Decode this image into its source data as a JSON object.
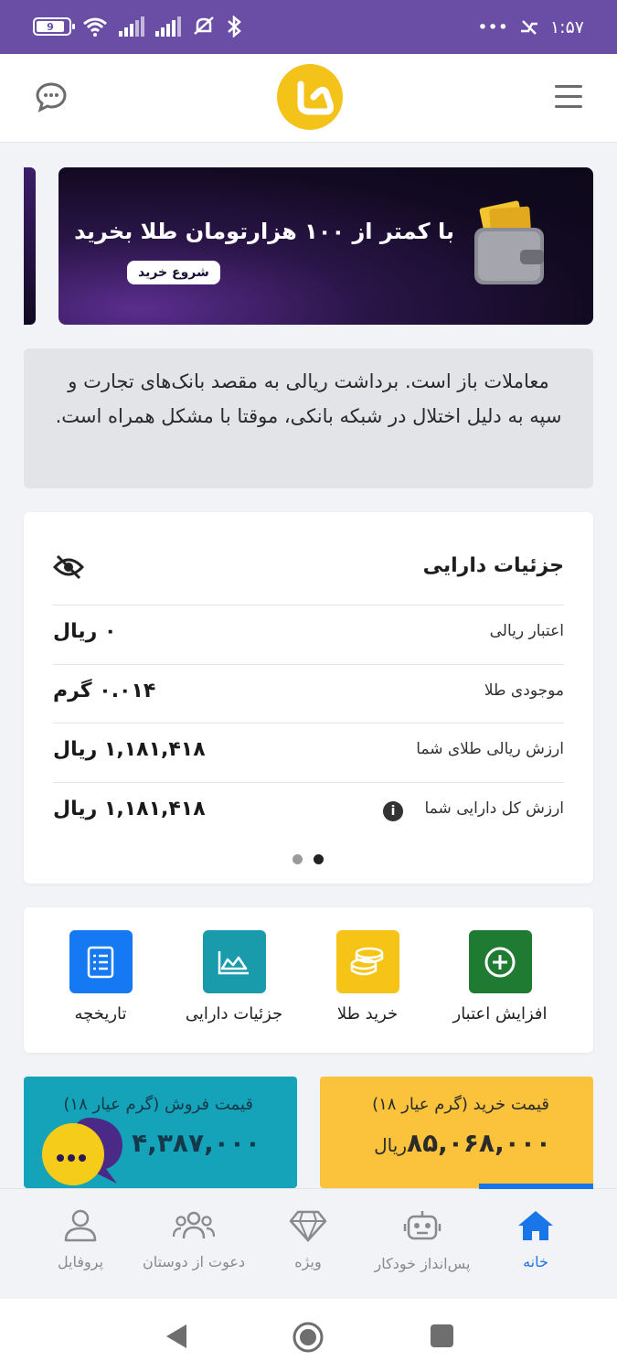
{
  "status_bar": {
    "time": "۱:۵۷",
    "battery": "9",
    "dots": "•••"
  },
  "banner": {
    "title": "با کمتر از ۱۰۰ هزارتومان طلا بخرید",
    "button": "شروع خرید"
  },
  "notice": {
    "text": "معاملات باز است. برداشت ریالی به مقصد بانک‌های تجارت و سپه به دلیل اختلال در شبکه بانکی، موقتا با مشکل همراه است."
  },
  "assets": {
    "title": "جزئیات دارایی",
    "rows": [
      {
        "label": "اعتبار ریالی",
        "value": "۰ ریال"
      },
      {
        "label": "موجودی طلا",
        "value": "۰.۰۱۴ گرم"
      },
      {
        "label": "ارزش ریالی طلای شما",
        "value": "۱,۱۸۱,۴۱۸ ریال"
      },
      {
        "label": "ارزش کل دارایی شما",
        "value": "۱,۱۸۱,۴۱۸ ریال",
        "info": "i"
      }
    ]
  },
  "actions": [
    {
      "label": "افزایش اعتبار",
      "icon": "plus-circle-icon",
      "color": "#1f7a32"
    },
    {
      "label": "خرید طلا",
      "icon": "coins-icon",
      "color": "#f6c416"
    },
    {
      "label": "جزئیات دارایی",
      "icon": "chart-icon",
      "color": "#1a9bab"
    },
    {
      "label": "تاریخچه",
      "icon": "list-icon",
      "color": "#1479f2"
    }
  ],
  "prices": {
    "buy": {
      "title": "قیمت خرید (گرم عیار ۱۸)",
      "amount": "۸۵,۰۶۸,۰۰۰",
      "unit": "ریال"
    },
    "sell": {
      "title": "قیمت فروش (گرم عیار ۱۸)",
      "amount": "۴,۳۸۷,۰۰۰"
    }
  },
  "bottom_nav": [
    {
      "label": "خانه",
      "icon": "home-icon",
      "active": true
    },
    {
      "label": "پس‌انداز خودکار",
      "icon": "robot-icon"
    },
    {
      "label": "ویژه",
      "icon": "diamond-icon"
    },
    {
      "label": "دعوت از دوستان",
      "icon": "friends-icon"
    },
    {
      "label": "پروفایل",
      "icon": "user-icon"
    }
  ],
  "colors": {
    "status_bar": "#6a4ea6",
    "accent": "#1976e8",
    "gold": "#f3c319",
    "buy_card": "#fbc33b",
    "sell_card": "#14a3b8"
  }
}
